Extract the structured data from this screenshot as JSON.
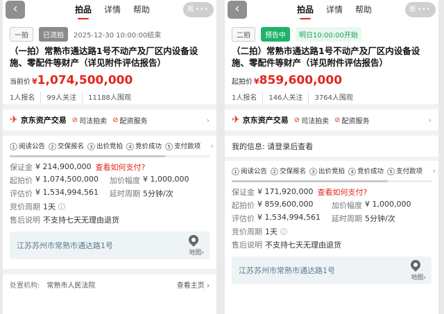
{
  "left": {
    "header": {
      "back": "‹",
      "tabs": [
        "拍品",
        "详情",
        "帮助"
      ],
      "gallery": "图",
      "dots": "•••"
    },
    "status": {
      "round": "一拍",
      "tag": "已流拍",
      "time": "2025-12-30 10:00:00结束"
    },
    "title": "（一拍）常熟市通达路1号不动产及厂区内设备设施、零配件等财产（详见附件评估报告）",
    "price": {
      "label": "当前价",
      "yen": "¥",
      "value": "1,074,500,000"
    },
    "meta": [
      "1人报名",
      "99人关注",
      "11188人围观"
    ],
    "jd": {
      "name": "京东资产交易",
      "svc1": "司法拍卖",
      "svc2": "配资服务"
    },
    "steps": [
      "阅读公告",
      "交保报名",
      "出价竞拍",
      "竞价成功",
      "支付款项"
    ],
    "steps_progress": 0.78,
    "deposit": {
      "k": "保证金",
      "v": "¥ 214,900,000",
      "link": "查看如何支付?"
    },
    "start": {
      "k": "起拍价",
      "v": "¥ 1,074,500,000"
    },
    "inc": {
      "k": "加价幅度",
      "v": "¥ 1,000,000"
    },
    "eval": {
      "k": "评估价",
      "v": "¥ 1,534,994,561"
    },
    "delay": {
      "k": "延时周期",
      "v": "5分钟/次"
    },
    "period": {
      "k": "竞价周期",
      "v": "1天"
    },
    "after": {
      "k": "售后说明",
      "v": "不支持七天无理由退货"
    },
    "map": {
      "addr": "江苏苏州市常熟市通达路1号",
      "label": "地图›"
    },
    "org": {
      "k": "处置机构:",
      "v": "常熟市人民法院",
      "r": "查看主页 ›"
    }
  },
  "right": {
    "header": {
      "back": "‹",
      "tabs": [
        "拍品",
        "详情",
        "帮助"
      ],
      "gallery": "图",
      "dots": "•••"
    },
    "status": {
      "round": "二拍",
      "tag": "预告中",
      "time": "明日10:00:00开始"
    },
    "title": "（二拍）常熟市通达路1号不动产及厂区内设备设施、零配件等财产（详见附件评估报告）",
    "price": {
      "label": "起拍价",
      "yen": "¥",
      "value": "859,600,000"
    },
    "meta": [
      "1人报名",
      "146人关注",
      "3764人围观"
    ],
    "jd": {
      "name": "京东资产交易",
      "svc1": "司法拍卖",
      "svc2": "配资服务"
    },
    "myinfo": "我的信息:  请登录后查看",
    "steps": [
      "阅读公告",
      "交保报名",
      "出价竞拍",
      "竞价成功",
      "支付款项"
    ],
    "steps_progress": 0.78,
    "deposit": {
      "k": "保证金",
      "v": "¥ 171,920,000",
      "link": "查看如何支付?"
    },
    "start": {
      "k": "起拍价",
      "v": "¥ 859,600,000"
    },
    "inc": {
      "k": "加价幅度",
      "v": "¥ 1,000,000"
    },
    "eval": {
      "k": "评估价",
      "v": "¥ 1,534,994,561"
    },
    "delay": {
      "k": "延时周期",
      "v": "5分钟/次"
    },
    "period": {
      "k": "竞价周期",
      "v": "1天"
    },
    "after": {
      "k": "售后说明",
      "v": "不支持七天无理由退货"
    },
    "map": {
      "addr": "江苏苏州市常熟市通达路1号",
      "label": "地图›"
    }
  },
  "colors": {
    "accent": "#e1251b",
    "green": "#1fb36b",
    "gray_tag": "#8a8a8a"
  }
}
